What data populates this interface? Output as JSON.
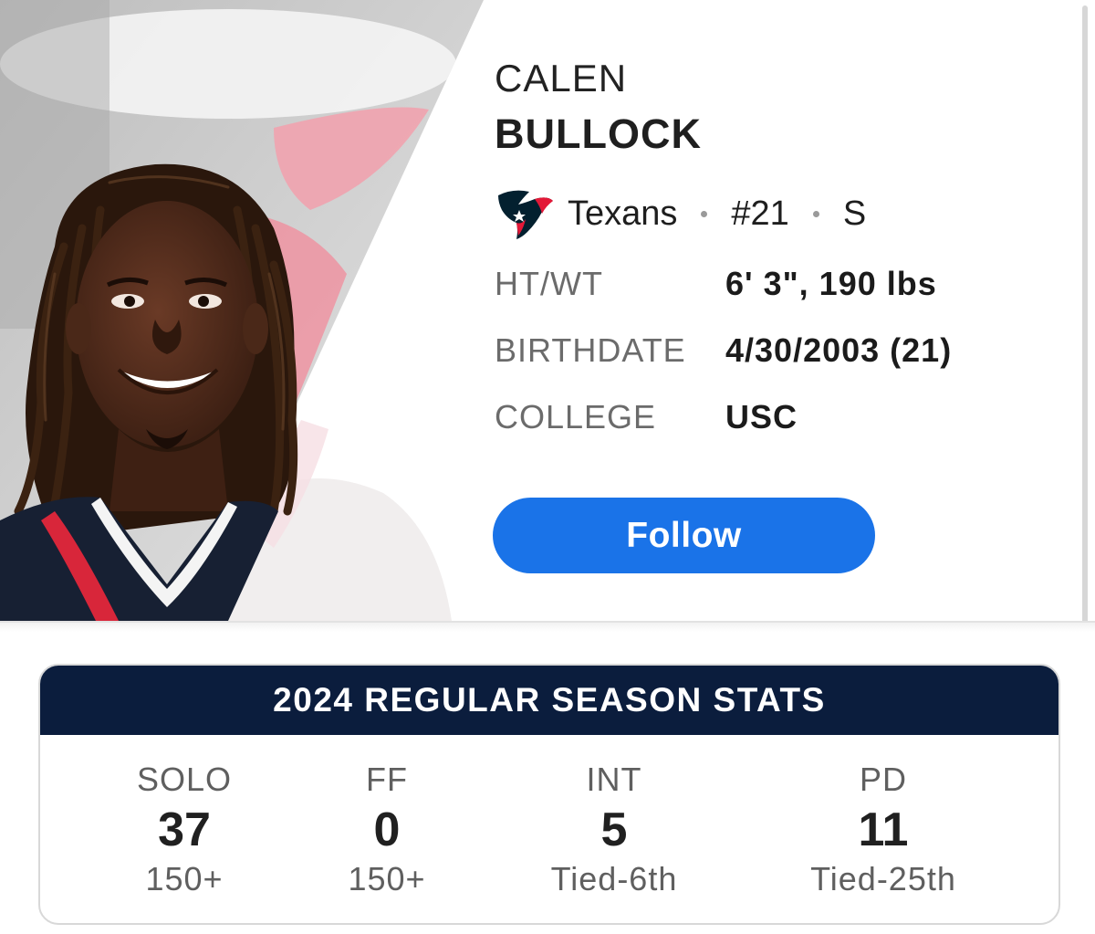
{
  "player": {
    "first_name": "CALEN",
    "last_name": "BULLOCK",
    "team": "Texans",
    "team_logo_icon": "texans-logo-icon",
    "number": "#21",
    "position": "S",
    "attributes": [
      {
        "label": "HT/WT",
        "value": "6' 3\", 190 lbs"
      },
      {
        "label": "BIRTHDATE",
        "value": "4/30/2003 (21)"
      },
      {
        "label": "COLLEGE",
        "value": "USC"
      }
    ],
    "follow_label": "Follow",
    "photo_icon": "player-headshot"
  },
  "stats": {
    "title": "2024 REGULAR SEASON STATS",
    "items": [
      {
        "label": "SOLO",
        "value": "37",
        "rank": "150+"
      },
      {
        "label": "FF",
        "value": "0",
        "rank": "150+"
      },
      {
        "label": "INT",
        "value": "5",
        "rank": "Tied-6th"
      },
      {
        "label": "PD",
        "value": "11",
        "rank": "Tied-25th"
      }
    ]
  },
  "colors": {
    "follow_button": "#1a73e8",
    "stats_header": "#0b1d3d",
    "texans_navy": "#03202f",
    "texans_red": "#e31837"
  }
}
